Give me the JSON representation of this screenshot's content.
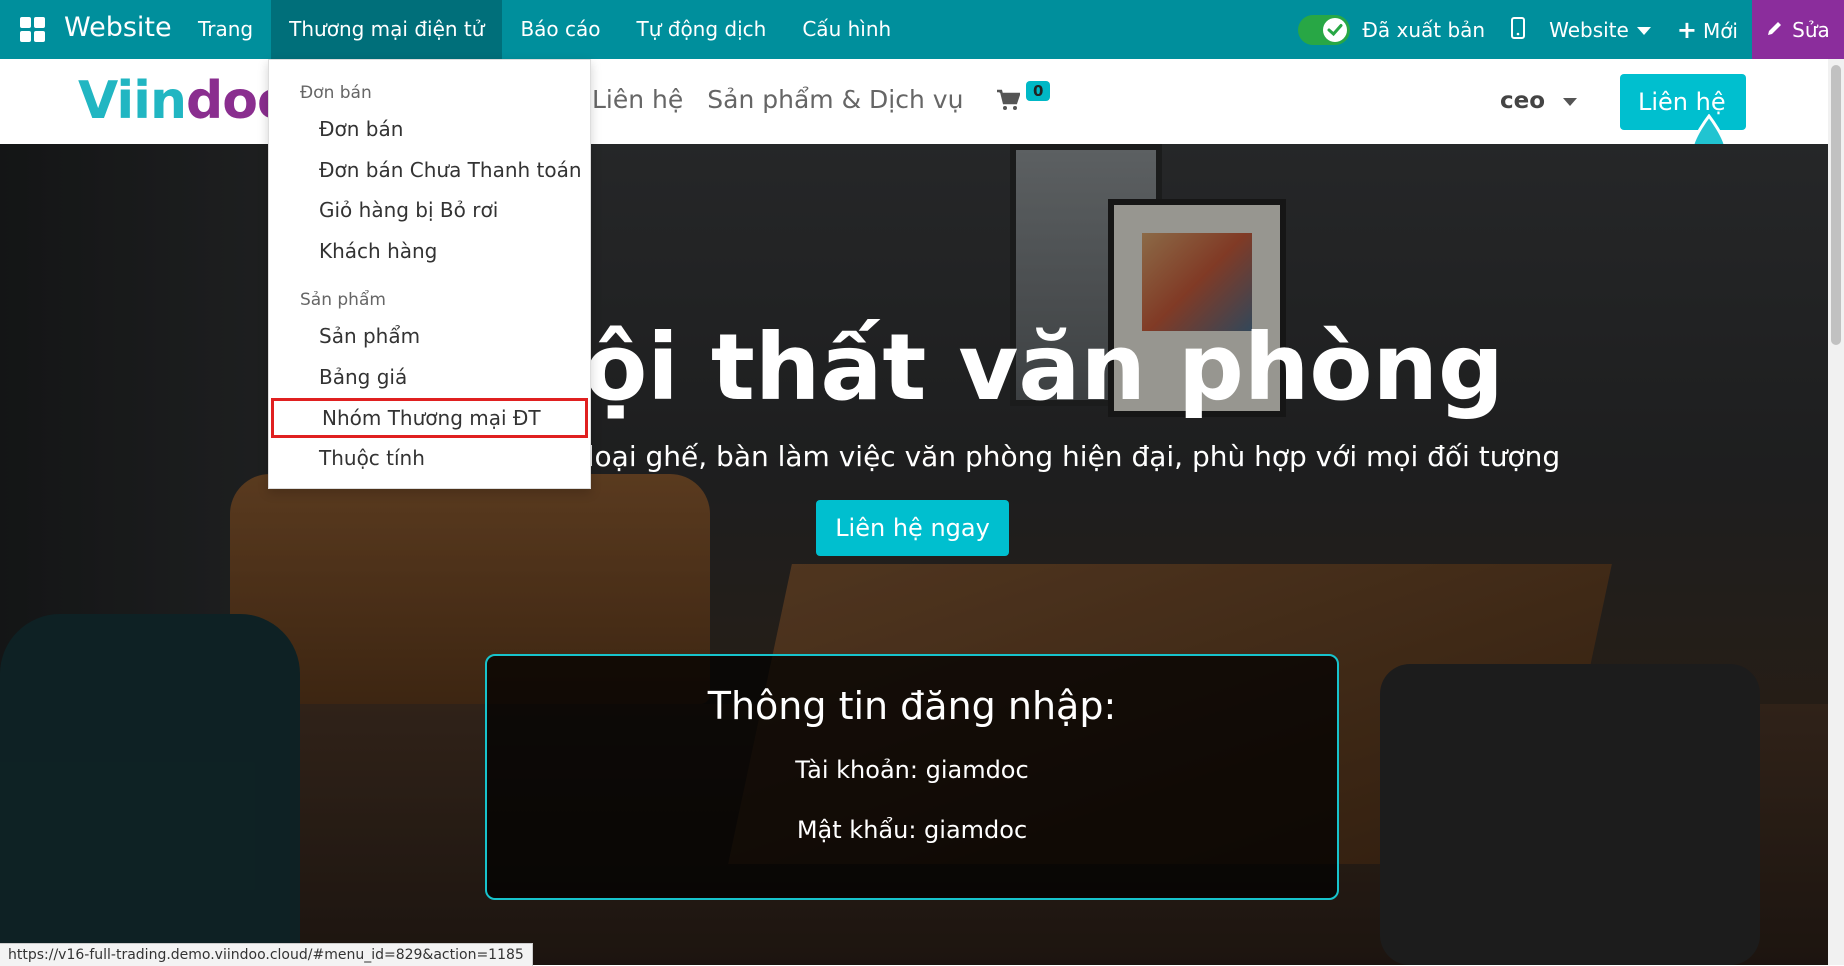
{
  "topbar": {
    "brand": "Website",
    "menu": [
      "Trang",
      "Thương mại điện tử",
      "Báo cáo",
      "Tự động dịch",
      "Cấu hình"
    ],
    "active_menu": "Thương mại điện tử",
    "published_label": "Đã xuất bản",
    "website_switch": "Website",
    "new_label": "Mới",
    "edit_label": "Sửa",
    "colors": {
      "bar": "#008f9c",
      "edit": "#8b2d9c",
      "toggle": "#28a745"
    }
  },
  "site_header": {
    "logo_text": "Viindoo",
    "nav": [
      "Liên hệ",
      "Sản phẩm & Dịch vụ"
    ],
    "cart_count": "0",
    "user": "ceo",
    "cta_label": "Liên hệ"
  },
  "dropdown": {
    "sections": [
      {
        "header": "Đơn bán",
        "items": [
          "Đơn bán",
          "Đơn bán Chưa Thanh toán",
          "Giỏ hàng bị Bỏ rơi",
          "Khách hàng"
        ]
      },
      {
        "header": "Sản phẩm",
        "items": [
          "Sản phẩm",
          "Bảng giá",
          "Nhóm Thương mại ĐT",
          "Thuộc tính"
        ]
      }
    ],
    "highlighted_item": "Nhóm Thương mại ĐT"
  },
  "hero": {
    "title": "ội thất văn phòng",
    "subtitle": "Đ                           các loại ghế, bàn làm việc văn phòng hiện đại, phù hợp với mọi đối tượng",
    "button_label": "Liên hệ ngay",
    "login_box": {
      "title": "Thông tin đăng nhập:",
      "account": "Tài khoản: giamdoc",
      "password": "Mật khẩu: giamdoc"
    }
  },
  "status_url": "https://v16-full-trading.demo.viindoo.cloud/#menu_id=829&action=1185"
}
